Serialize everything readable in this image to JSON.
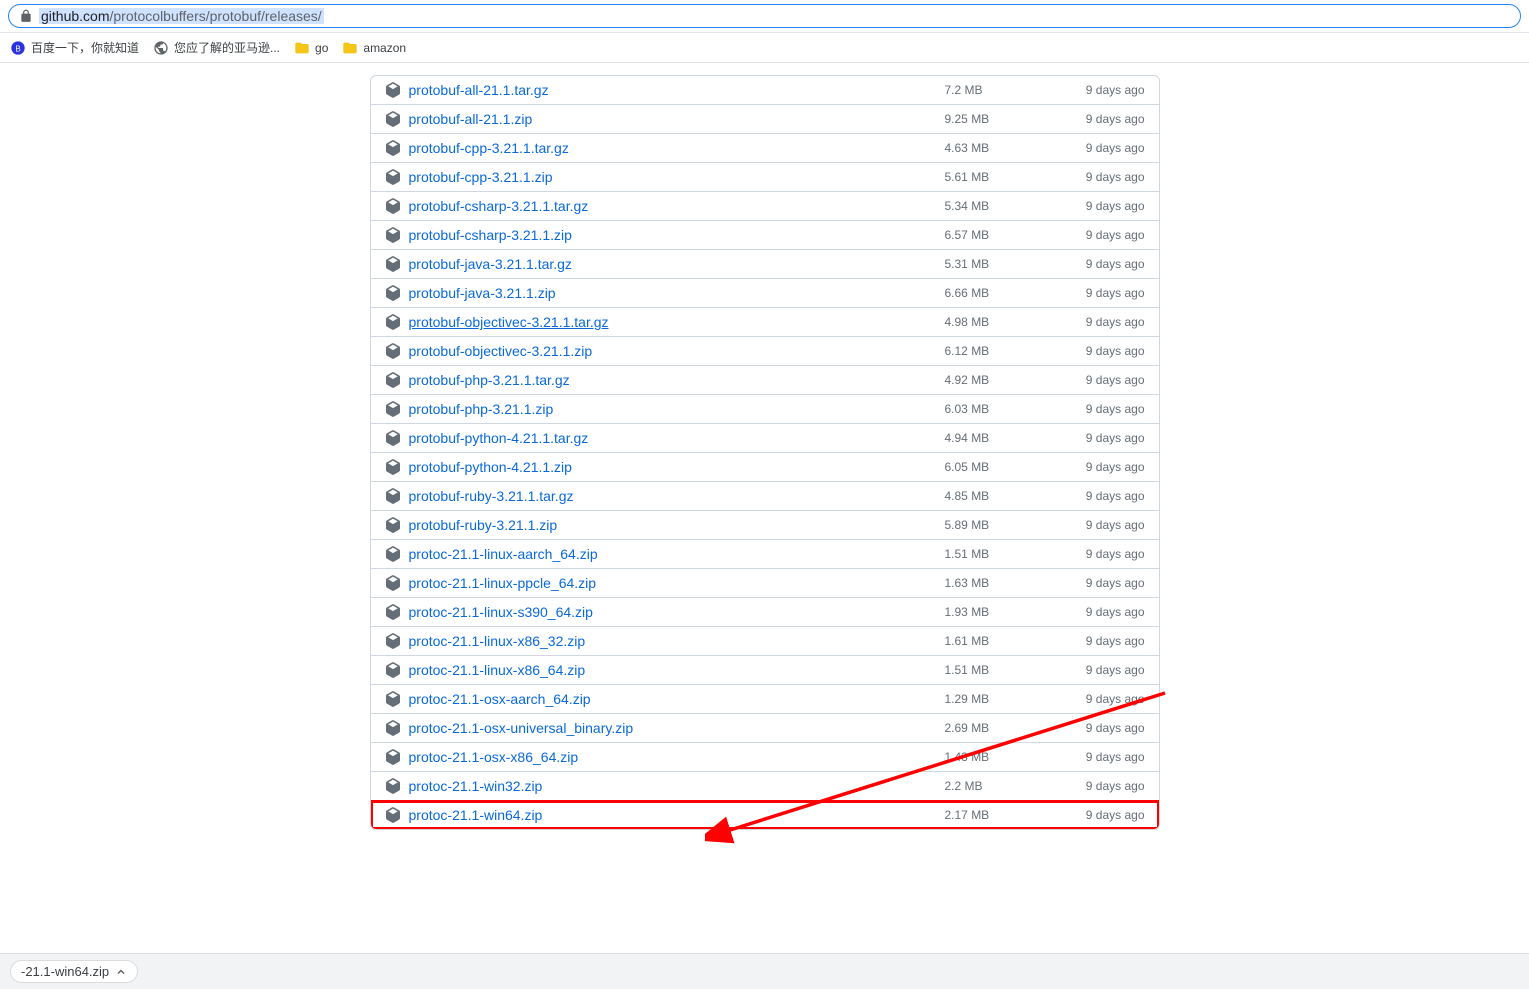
{
  "address_bar": {
    "url_host": "github.com",
    "url_path": "/protocolbuffers/protobuf/releases/"
  },
  "bookmarks": [
    {
      "label": "百度一下，你就知道",
      "icon": "baidu"
    },
    {
      "label": "您应了解的亚马逊...",
      "icon": "globe"
    },
    {
      "label": "go",
      "icon": "folder"
    },
    {
      "label": "amazon",
      "icon": "folder"
    }
  ],
  "assets": [
    {
      "name": "protobuf-all-21.1.tar.gz",
      "size": "7.2 MB",
      "time": "9 days ago"
    },
    {
      "name": "protobuf-all-21.1.zip",
      "size": "9.25 MB",
      "time": "9 days ago"
    },
    {
      "name": "protobuf-cpp-3.21.1.tar.gz",
      "size": "4.63 MB",
      "time": "9 days ago"
    },
    {
      "name": "protobuf-cpp-3.21.1.zip",
      "size": "5.61 MB",
      "time": "9 days ago"
    },
    {
      "name": "protobuf-csharp-3.21.1.tar.gz",
      "size": "5.34 MB",
      "time": "9 days ago"
    },
    {
      "name": "protobuf-csharp-3.21.1.zip",
      "size": "6.57 MB",
      "time": "9 days ago"
    },
    {
      "name": "protobuf-java-3.21.1.tar.gz",
      "size": "5.31 MB",
      "time": "9 days ago"
    },
    {
      "name": "protobuf-java-3.21.1.zip",
      "size": "6.66 MB",
      "time": "9 days ago"
    },
    {
      "name": "protobuf-objectivec-3.21.1.tar.gz",
      "size": "4.98 MB",
      "time": "9 days ago",
      "underlined": true
    },
    {
      "name": "protobuf-objectivec-3.21.1.zip",
      "size": "6.12 MB",
      "time": "9 days ago"
    },
    {
      "name": "protobuf-php-3.21.1.tar.gz",
      "size": "4.92 MB",
      "time": "9 days ago"
    },
    {
      "name": "protobuf-php-3.21.1.zip",
      "size": "6.03 MB",
      "time": "9 days ago"
    },
    {
      "name": "protobuf-python-4.21.1.tar.gz",
      "size": "4.94 MB",
      "time": "9 days ago"
    },
    {
      "name": "protobuf-python-4.21.1.zip",
      "size": "6.05 MB",
      "time": "9 days ago"
    },
    {
      "name": "protobuf-ruby-3.21.1.tar.gz",
      "size": "4.85 MB",
      "time": "9 days ago"
    },
    {
      "name": "protobuf-ruby-3.21.1.zip",
      "size": "5.89 MB",
      "time": "9 days ago"
    },
    {
      "name": "protoc-21.1-linux-aarch_64.zip",
      "size": "1.51 MB",
      "time": "9 days ago"
    },
    {
      "name": "protoc-21.1-linux-ppcle_64.zip",
      "size": "1.63 MB",
      "time": "9 days ago"
    },
    {
      "name": "protoc-21.1-linux-s390_64.zip",
      "size": "1.93 MB",
      "time": "9 days ago"
    },
    {
      "name": "protoc-21.1-linux-x86_32.zip",
      "size": "1.61 MB",
      "time": "9 days ago"
    },
    {
      "name": "protoc-21.1-linux-x86_64.zip",
      "size": "1.51 MB",
      "time": "9 days ago"
    },
    {
      "name": "protoc-21.1-osx-aarch_64.zip",
      "size": "1.29 MB",
      "time": "9 days ago"
    },
    {
      "name": "protoc-21.1-osx-universal_binary.zip",
      "size": "2.69 MB",
      "time": "9 days ago"
    },
    {
      "name": "protoc-21.1-osx-x86_64.zip",
      "size": "1.43 MB",
      "time": "9 days ago"
    },
    {
      "name": "protoc-21.1-win32.zip",
      "size": "2.2 MB",
      "time": "9 days ago"
    },
    {
      "name": "protoc-21.1-win64.zip",
      "size": "2.17 MB",
      "time": "9 days ago",
      "highlight": true
    }
  ],
  "download_shelf": {
    "filename": "-21.1-win64.zip"
  }
}
